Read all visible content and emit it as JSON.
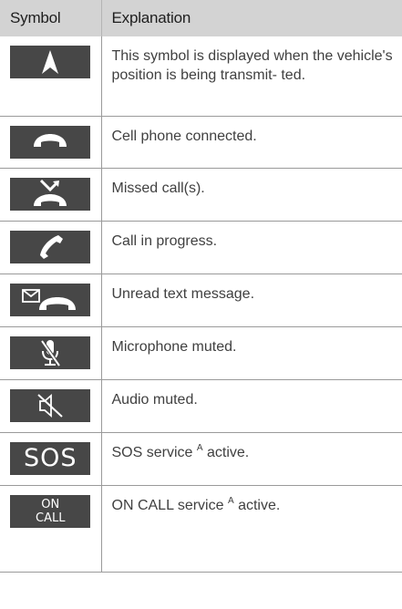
{
  "header": {
    "symbol": "Symbol",
    "explanation": "Explanation"
  },
  "rows": [
    {
      "icon": "navigation-arrow-icon",
      "text": "This symbol is displayed when the vehicle's position is being transmit- ted."
    },
    {
      "icon": "phone-connected-icon",
      "text": "Cell phone connected."
    },
    {
      "icon": "missed-call-icon",
      "text": "Missed call(s)."
    },
    {
      "icon": "call-in-progress-icon",
      "text": "Call in progress."
    },
    {
      "icon": "unread-message-icon",
      "text": "Unread text message."
    },
    {
      "icon": "microphone-muted-icon",
      "text": "Microphone muted."
    },
    {
      "icon": "audio-muted-icon",
      "text": "Audio muted."
    },
    {
      "icon": "sos-icon",
      "icon_text": "SOS",
      "text_before": "SOS service ",
      "superscript": "A",
      "text_after": " active."
    },
    {
      "icon": "on-call-icon",
      "icon_text_line1": "ON",
      "icon_text_line2": "CALL",
      "text_before": "ON CALL service ",
      "superscript": "A",
      "text_after": " active."
    }
  ],
  "colors": {
    "icon_background": "#474747",
    "header_background": "#d3d3d3"
  }
}
